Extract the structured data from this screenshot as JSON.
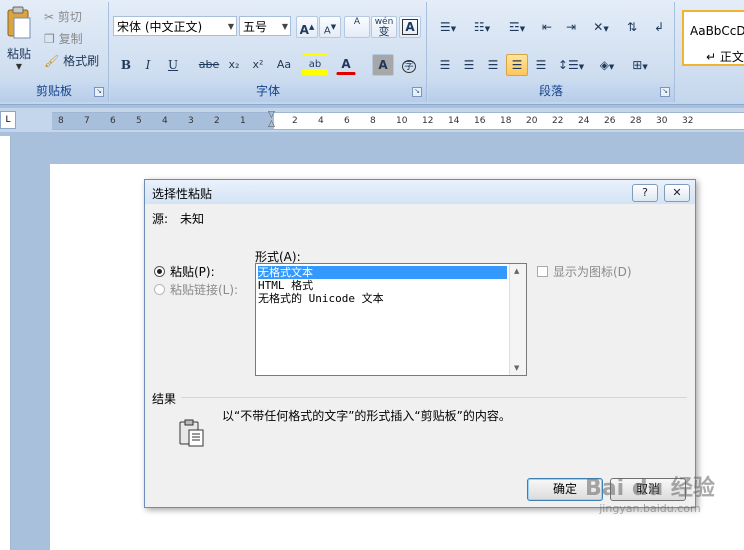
{
  "ribbon": {
    "clipboard": {
      "title": "剪贴板",
      "paste_label": "粘贴",
      "cut_label": "剪切",
      "copy_label": "复制",
      "format_painter_label": "格式刷"
    },
    "font": {
      "title": "字体",
      "font_name": "宋体 (中文正文)",
      "font_size": "五号",
      "grow_label": "A",
      "shrink_label": "A",
      "bold": "B",
      "italic": "I",
      "underline": "U",
      "strike": "abe",
      "subscript": "x₂",
      "superscript": "x²",
      "change_case": "Aa",
      "highlight": "ab",
      "font_color": "A",
      "char_shade": "A",
      "enclose": "字",
      "phonetic": "wén",
      "phonetic_char": "变",
      "clear": "A"
    },
    "paragraph": {
      "title": "段落"
    },
    "styles": {
      "preview": "AaBbCcDc",
      "name": "↵ 正文"
    }
  },
  "ruler": {
    "left_ticks": [
      "8",
      "7",
      "6",
      "5",
      "4",
      "3",
      "2",
      "1"
    ],
    "right_ticks": [
      "2",
      "4",
      "6",
      "8",
      "10",
      "12",
      "14",
      "16",
      "18",
      "20",
      "22",
      "24",
      "26",
      "28",
      "30",
      "32"
    ]
  },
  "dialog": {
    "title": "选择性粘贴",
    "help_label": "?",
    "close_label": "✕",
    "source_label": "源:",
    "source_value": "未知",
    "as_label": "形式(A):",
    "paste_option": "粘贴(P):",
    "paste_link_option": "粘贴链接(L):",
    "formats": [
      "无格式文本",
      "HTML 格式",
      "无格式的 Unicode 文本"
    ],
    "display_as_icon": "显示为图标(D)",
    "result_label": "结果",
    "result_text": "以“不带任何格式的文字”的形式插入“剪贴板”的内容。",
    "ok_label": "确定",
    "cancel_label": "取消"
  },
  "watermark": {
    "brand": "Bai du 经验",
    "url": "jingyan.baidu.com"
  }
}
